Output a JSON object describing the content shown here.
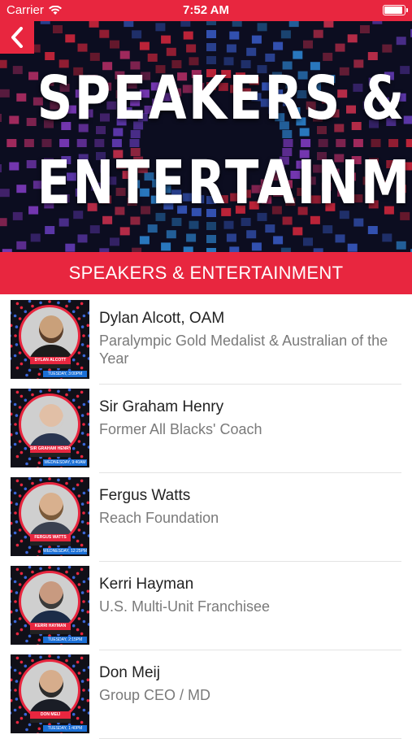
{
  "status_bar": {
    "carrier": "Carrier",
    "time": "7:52 AM"
  },
  "banner": {
    "line1": "SPEAKERS &",
    "line2": "ENTERTAINMENT"
  },
  "section": {
    "title": "SPEAKERS & ENTERTAINMENT"
  },
  "speakers": [
    {
      "name": "Dylan Alcott, OAM",
      "role": "Paralympic Gold Medalist & Australian of the Year",
      "tag": "DYLAN ALCOTT",
      "slot": "TUESDAY, 3:00PM"
    },
    {
      "name": "Sir Graham Henry",
      "role": "Former All Blacks' Coach",
      "tag": "SIR GRAHAM HENRY",
      "slot": "WEDNESDAY, 9:40AM"
    },
    {
      "name": "Fergus Watts",
      "role": "Reach Foundation",
      "tag": "FERGUS WATTS",
      "slot": "WEDNESDAY, 12:25PM"
    },
    {
      "name": "Kerri Hayman",
      "role": "U.S. Multi-Unit Franchisee",
      "tag": "KERRI HAYMAN",
      "slot": "TUESDAY, 2:15PM"
    },
    {
      "name": "Don Meij",
      "role": "Group CEO / MD",
      "tag": "DON MEIJ",
      "slot": "TUESDAY, 1:40PM"
    }
  ],
  "colors": {
    "accent": "#e8263f",
    "banner_bg": "#0c0d20"
  }
}
